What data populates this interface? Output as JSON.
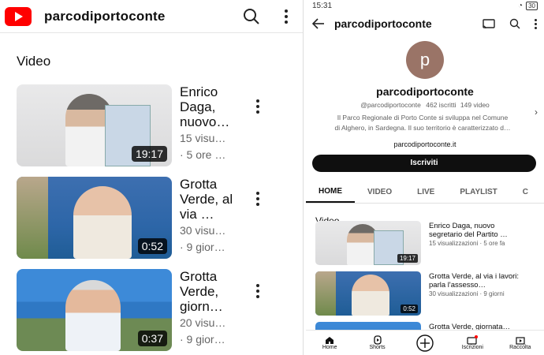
{
  "left": {
    "channel_name": "parcodiportoconte",
    "section": "Video",
    "videos": [
      {
        "title": "Enrico Daga, nuovo…",
        "views": "15 visu…",
        "age": "· 5 ore …",
        "duration": "19:17"
      },
      {
        "title": "Grotta Verde, al via …",
        "views": "30 visu…",
        "age": "· 9 gior…",
        "duration": "0:52"
      },
      {
        "title": "Grotta Verde, giorn…",
        "views": "20 visu…",
        "age": "· 9 gior…",
        "duration": "0:37"
      }
    ]
  },
  "right": {
    "status": {
      "time": "15:31",
      "battery": "30"
    },
    "channel_name": "parcodiportoconte",
    "avatar_letter": "p",
    "name": "parcodiportoconte",
    "handle": "@parcodiportoconte",
    "subscribers": "462 iscritti",
    "videos_count": "149 video",
    "description_line1": "Il Parco Regionale di Porto Conte si sviluppa nel Comune",
    "description_line2": "di Alghero, in Sardegna. Il suo territorio è caratterizzato d…",
    "link": "parcodiportoconte.it",
    "subscribe_label": "Iscriviti",
    "tabs": [
      "HOME",
      "VIDEO",
      "LIVE",
      "PLAYLIST",
      "C"
    ],
    "section": "Video",
    "videos": [
      {
        "title": "Enrico Daga, nuovo segretario del Partito …",
        "meta": "15 visualizzazioni · 5 ore fa",
        "duration": "19:17"
      },
      {
        "title": "Grotta Verde, al via i lavori: parla l'assesso…",
        "meta": "30 visualizzazioni · 9 giorni",
        "duration": "0:52"
      },
      {
        "title": "Grotta Verde, giornata…",
        "meta": "",
        "duration": ""
      }
    ],
    "nav": [
      "Home",
      "Shorts",
      "",
      "Iscrizioni",
      "Raccolta"
    ]
  },
  "colors": {
    "youtube_red": "#ff0000",
    "button_black": "#0f0f0f",
    "avatar": "#9a7467"
  }
}
